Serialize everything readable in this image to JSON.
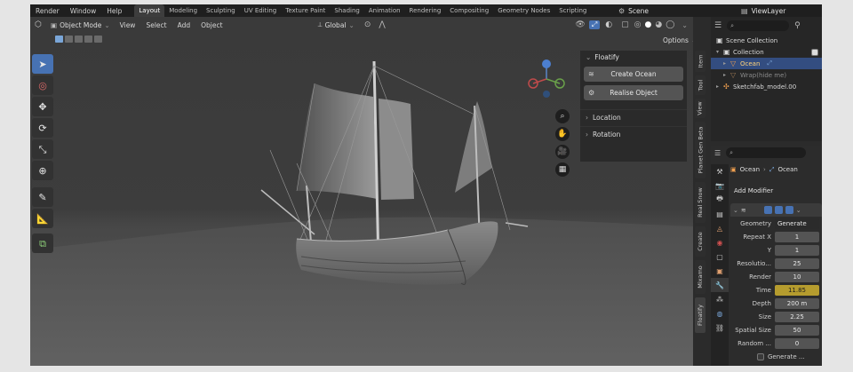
{
  "topbar": {
    "menus": [
      "Render",
      "Window",
      "Help"
    ],
    "workspaces": [
      "Layout",
      "Modeling",
      "Sculpting",
      "UV Editing",
      "Texture Paint",
      "Shading",
      "Animation",
      "Rendering",
      "Compositing",
      "Geometry Nodes",
      "Scripting"
    ],
    "active_workspace": "Layout",
    "scene_label": "Scene",
    "view_layer_label": "ViewLayer"
  },
  "viewport": {
    "mode": "Object Mode",
    "menus": [
      "View",
      "Select",
      "Add",
      "Object"
    ],
    "transform_orientation": "Global",
    "options_label": "Options"
  },
  "floatify_panel": {
    "title": "Floatify",
    "create_button": "Create Ocean",
    "realise_button": "Realise Object",
    "location_label": "Location",
    "rotation_label": "Rotation"
  },
  "side_tabs": [
    "Item",
    "Tool",
    "View",
    "Planet Gen Beta",
    "Real Snow",
    "Create",
    "Mixamo",
    "Floatify"
  ],
  "active_side_tab": "Floatify",
  "outliner": {
    "rows": [
      {
        "label": "Scene Collection",
        "icon": "collection-icon"
      },
      {
        "label": "Collection",
        "icon": "collection-icon"
      },
      {
        "label": "Ocean",
        "icon": "mesh-icon"
      },
      {
        "label": "Wrap(hide me)",
        "icon": "mesh-icon"
      },
      {
        "label": "Sketchfab_model.00",
        "icon": "armature-icon"
      }
    ]
  },
  "properties": {
    "breadcrumb_object": "Ocean",
    "breadcrumb_modifier": "Ocean",
    "add_modifier": "Add Modifier",
    "geometry_label": "Geometry",
    "geometry_value": "Generate",
    "rows": [
      {
        "label": "Repeat X",
        "value": "1"
      },
      {
        "label": "Y",
        "value": "1"
      },
      {
        "label": "Resolutio...",
        "value": "25"
      },
      {
        "label": "Render",
        "value": "10"
      },
      {
        "label": "Time",
        "value": "11.85"
      },
      {
        "label": "Depth",
        "value": "200 m"
      },
      {
        "label": "Size",
        "value": "2.25"
      },
      {
        "label": "Spatial Size",
        "value": "50"
      },
      {
        "label": "Random ...",
        "value": "0"
      }
    ],
    "generate_checkbox": "Generate ..."
  },
  "colors": {
    "accent_blue": "#4772b3",
    "time_highlight": "#b59c2e",
    "selected_text": "#ffd37a"
  }
}
